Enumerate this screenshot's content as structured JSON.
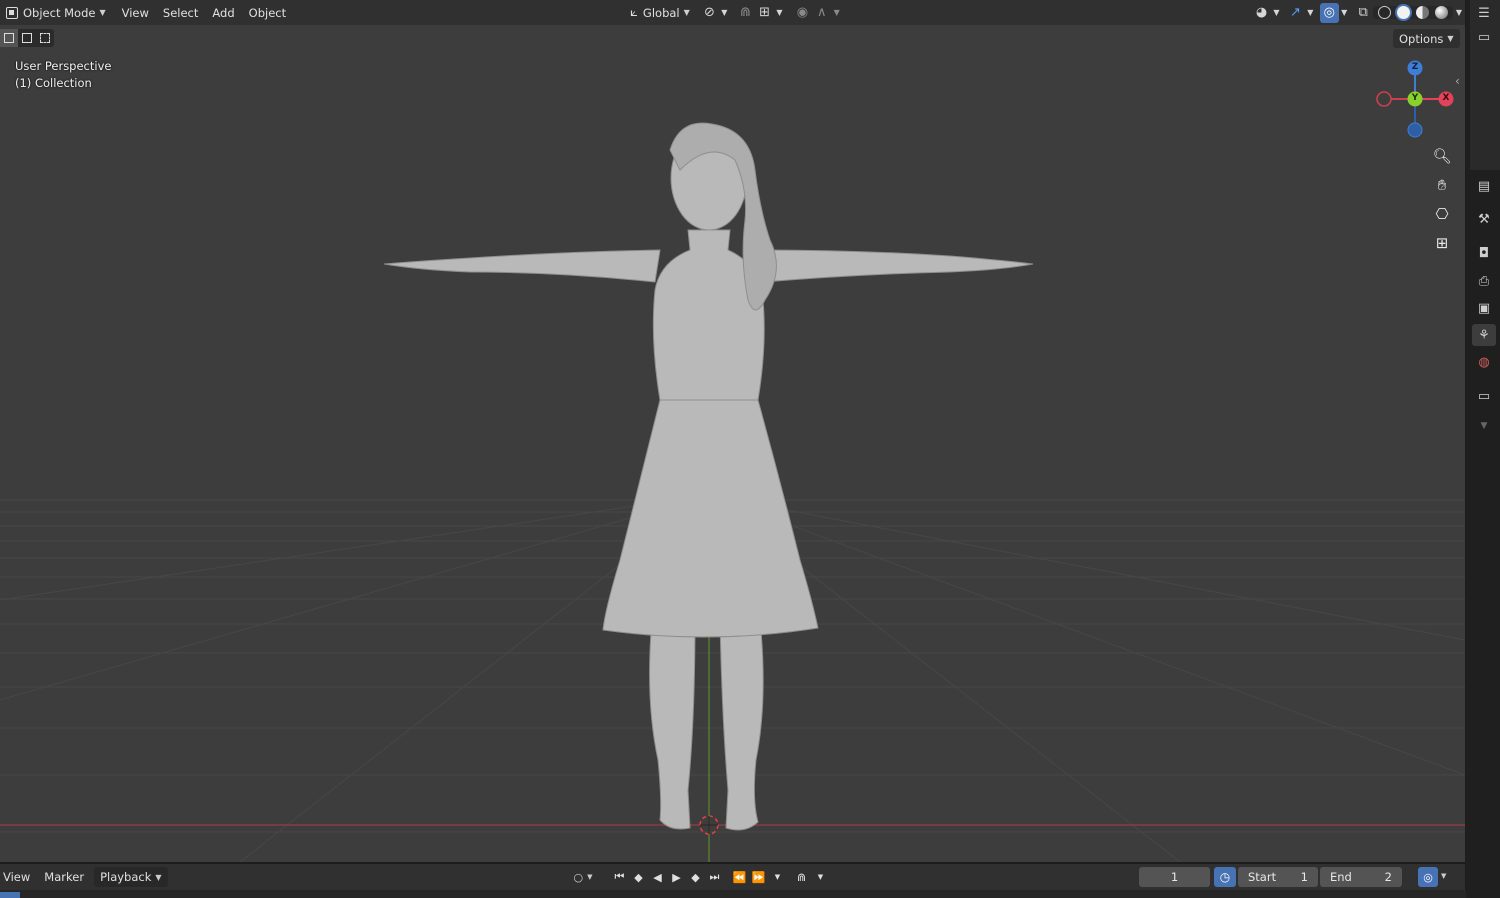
{
  "header": {
    "mode": "Object Mode",
    "menus": [
      "View",
      "Select",
      "Add",
      "Object"
    ],
    "orientation": "Global",
    "options_label": "Options"
  },
  "viewport": {
    "perspective_label": "User Perspective",
    "collection_label": "(1) Collection",
    "gizmo": {
      "z": "Z",
      "y": "Y",
      "x": "X"
    },
    "nav_icons": [
      "zoom-icon",
      "hand-pan-icon",
      "camera-icon",
      "grid-ortho-icon"
    ]
  },
  "timeline": {
    "menus": {
      "view": "View",
      "marker": "Marker",
      "playback": "Playback"
    },
    "current_frame": "1",
    "start_label": "Start",
    "start_value": "1",
    "end_label": "End",
    "end_value": "2"
  },
  "colors": {
    "accent": "#4772b3",
    "x_axis": "#e0435a",
    "y_axis": "#8bd12b",
    "z_axis": "#3d7fd6"
  }
}
